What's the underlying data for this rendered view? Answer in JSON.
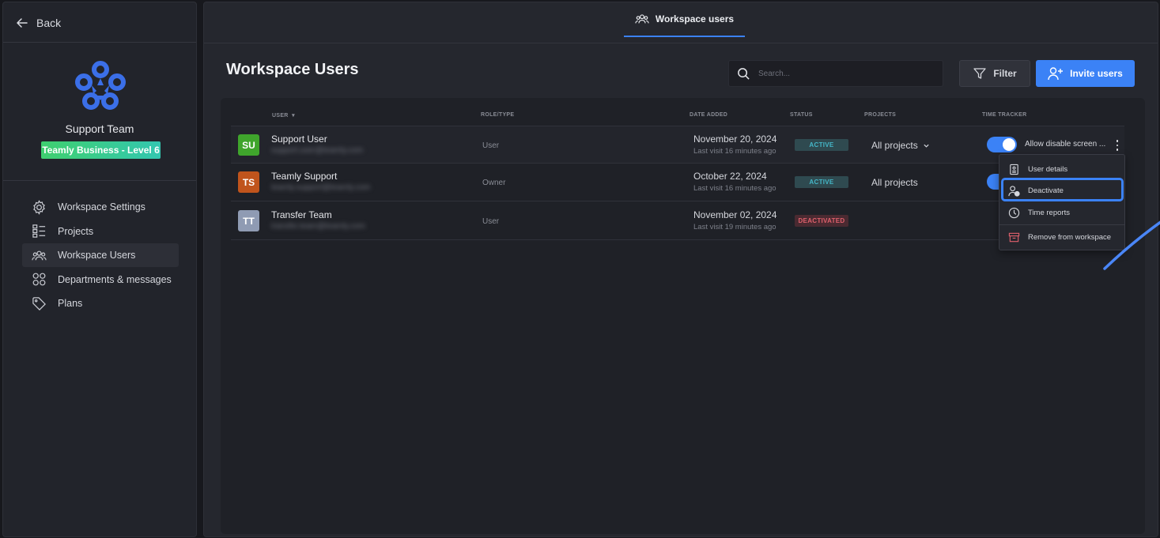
{
  "sidebar": {
    "back_label": "Back",
    "team_name": "Support Team",
    "plan_badge": "Teamly Business - Level 6",
    "items": [
      {
        "label": "Workspace Settings"
      },
      {
        "label": "Projects"
      },
      {
        "label": "Workspace Users"
      },
      {
        "label": "Departments & messages"
      },
      {
        "label": "Plans"
      }
    ]
  },
  "topbar": {
    "tab_label": "Workspace users"
  },
  "header": {
    "title": "Workspace Users",
    "search_placeholder": "Search...",
    "filter_label": "Filter",
    "invite_label": "Invite users"
  },
  "table": {
    "columns": {
      "user": "USER",
      "role": "ROLE/TYPE",
      "date": "DATE ADDED",
      "status": "STATUS",
      "projects": "PROJECTS",
      "tracker": "TIME TRACKER"
    },
    "rows": [
      {
        "initials": "SU",
        "avatar_color": "#3fa52c",
        "name": "Support User",
        "email": "support.user@teamly.com",
        "role": "User",
        "date": "November 20, 2024",
        "last_visit": "Last visit 16 minutes ago",
        "status": "ACTIVE",
        "projects": "All projects",
        "tracker_label": "Allow disable screen ..."
      },
      {
        "initials": "TS",
        "avatar_color": "#c0541c",
        "name": "Teamly Support",
        "email": "teamly.support@teamly.com",
        "role": "Owner",
        "date": "October 22, 2024",
        "last_visit": "Last visit 16 minutes ago",
        "status": "ACTIVE",
        "projects": "All projects"
      },
      {
        "initials": "TT",
        "avatar_color": "#8f9bb3",
        "name": "Transfer Team",
        "email": "transfer.team@teamly.com",
        "role": "User",
        "date": "November 02, 2024",
        "last_visit": "Last visit 19 minutes ago",
        "status": "DEACTIVATED"
      }
    ]
  },
  "dropdown": {
    "items": [
      {
        "label": "User details"
      },
      {
        "label": "Deactivate"
      },
      {
        "label": "Time reports"
      },
      {
        "label": "Remove from workspace"
      }
    ]
  },
  "colors": {
    "accent": "#3b82f6",
    "active_status": "#45b7c8",
    "deactivated_status": "#e0606c"
  }
}
